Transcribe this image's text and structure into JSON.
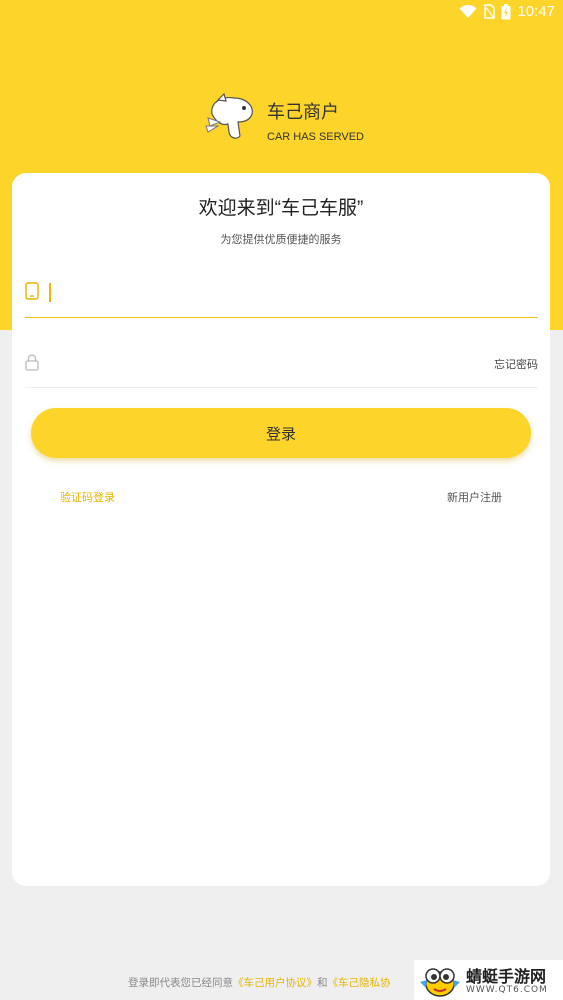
{
  "status_bar": {
    "time": "10:47",
    "icons": [
      "wifi-icon",
      "no-sim-icon",
      "battery-icon"
    ]
  },
  "brand": {
    "name": "车己商户",
    "subtitle": "CAR HAS SERVED",
    "logo": "mascot-icon"
  },
  "card": {
    "title": "欢迎来到“车己车服”",
    "subtitle": "为您提供优质便捷的服务",
    "phone": {
      "value": "",
      "placeholder": "",
      "icon": "phone-icon"
    },
    "password": {
      "value": "",
      "placeholder": "",
      "icon": "lock-icon"
    },
    "forgot_label": "忘记密码",
    "login_label": "登录",
    "sms_login_label": "验证码登录",
    "register_label": "新用户注册"
  },
  "agreement": {
    "prefix": "登录即代表您已经同意",
    "user_agreement": "《车己用户协议》",
    "and": "和",
    "privacy": "《车己隐私协"
  },
  "watermark": {
    "name": "蜻蜓手游网",
    "url": "WWW.QT6.COM"
  },
  "colors": {
    "accent": "#fdd42a",
    "link": "#e6b400",
    "background": "#efefef"
  }
}
